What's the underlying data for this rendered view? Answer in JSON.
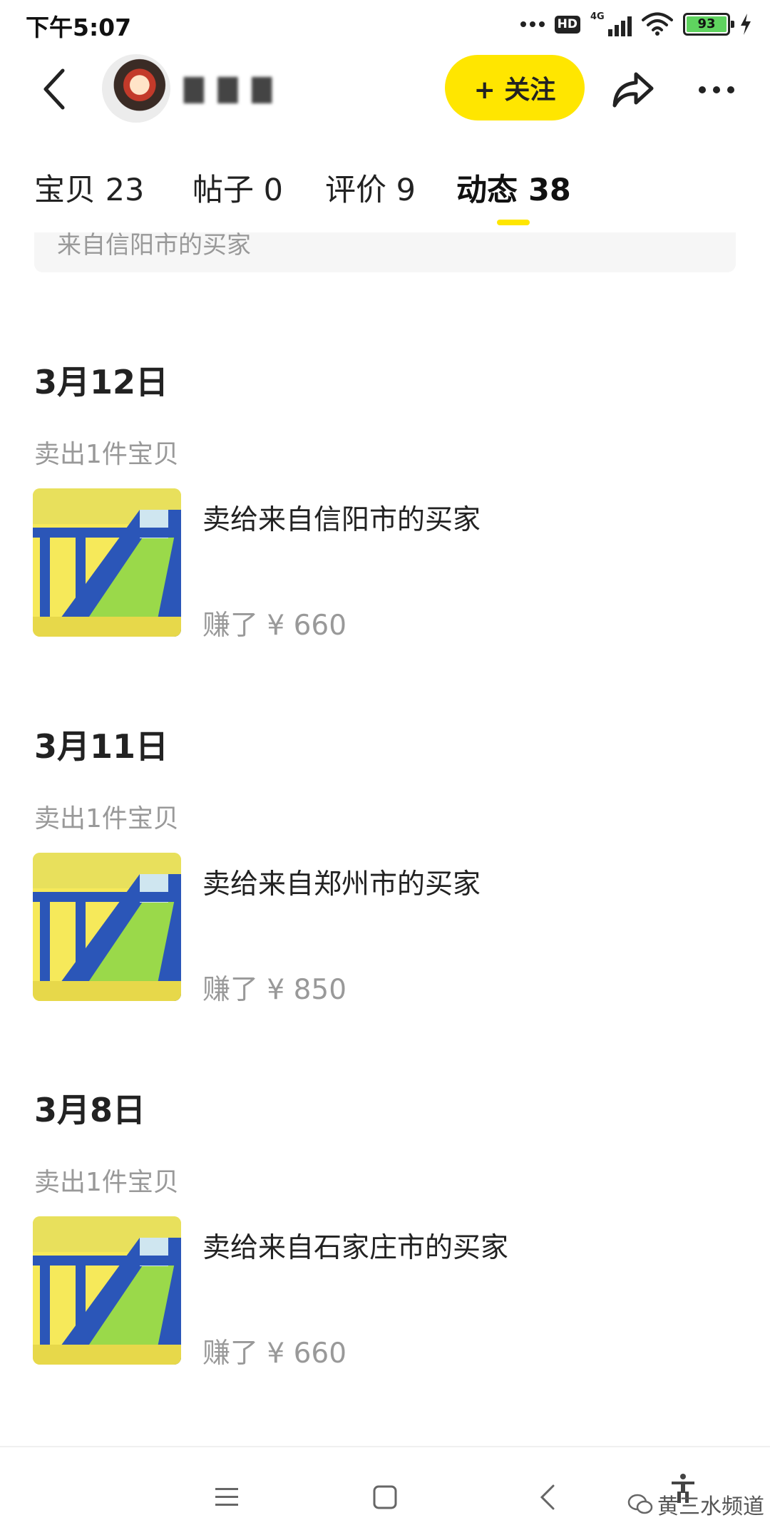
{
  "status_bar": {
    "time": "下午5:07",
    "hd_label": "HD",
    "network_label": "4G",
    "battery_level": "93"
  },
  "header": {
    "follow_label": "+ 关注",
    "icons": [
      "back-arrow-icon",
      "share-icon",
      "more-icon"
    ]
  },
  "tabs": [
    {
      "label": "宝贝 23"
    },
    {
      "label": "帖子 0"
    },
    {
      "label": "评价 9"
    },
    {
      "label": "动态 38",
      "active": true
    }
  ],
  "feed": {
    "previous_card_text": "来自信阳市的买家",
    "items": [
      {
        "date": "3月12日",
        "meta": "卖出1件宝贝",
        "buyer": "卖给来自信阳市的买家",
        "earned": "赚了 ¥ 660"
      },
      {
        "date": "3月11日",
        "meta": "卖出1件宝贝",
        "buyer": "卖给来自郑州市的买家",
        "earned": "赚了 ¥ 850"
      },
      {
        "date": "3月8日",
        "meta": "卖出1件宝贝",
        "buyer": "卖给来自石家庄市的买家",
        "earned": "赚了 ¥ 660"
      }
    ]
  },
  "bottom_nav": {
    "icons": [
      "menu-icon",
      "home-icon",
      "back-icon",
      "accessibility-icon"
    ],
    "watermark": "黄三水频道"
  },
  "colors": {
    "accent_yellow": "#ffe600",
    "text_primary": "#222222",
    "text_secondary": "#999999",
    "battery_green": "#5fd35f"
  }
}
